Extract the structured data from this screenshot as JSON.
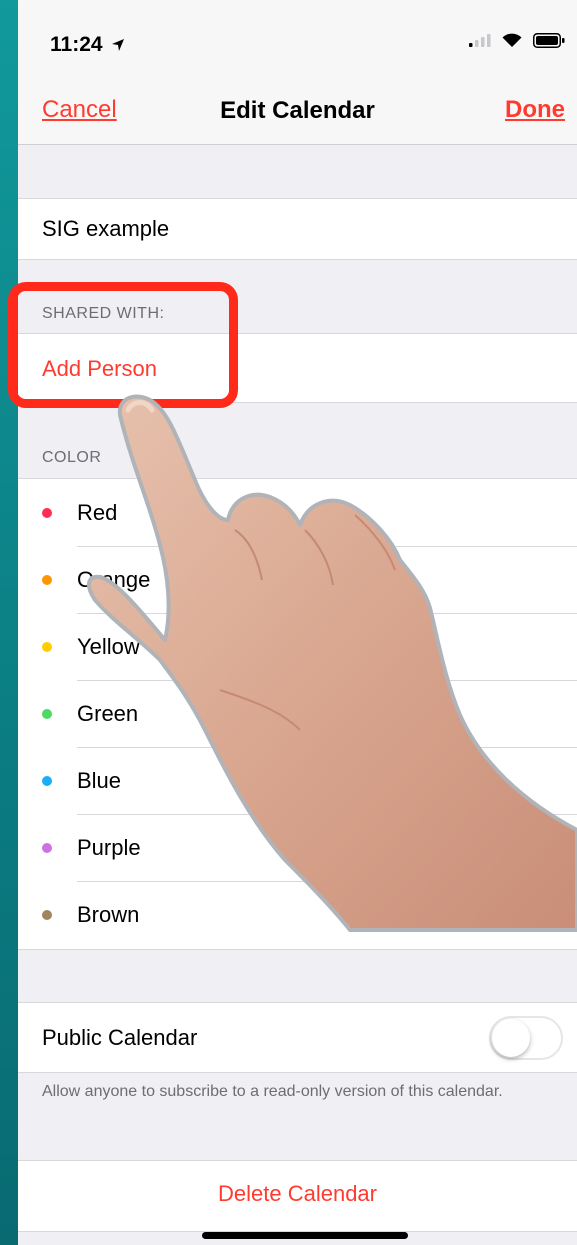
{
  "status_bar": {
    "time": "11:24"
  },
  "nav": {
    "cancel": "Cancel",
    "title": "Edit Calendar",
    "done": "Done"
  },
  "calendar_name": "SIG example",
  "shared": {
    "header": "SHARED WITH:",
    "add_person": "Add Person"
  },
  "color": {
    "header": "COLOR",
    "options": [
      {
        "label": "Red",
        "color": "#ff2d55"
      },
      {
        "label": "Orange",
        "color": "#ff9500"
      },
      {
        "label": "Yellow",
        "color": "#ffcc00"
      },
      {
        "label": "Green",
        "color": "#4cd964"
      },
      {
        "label": "Blue",
        "color": "#1badf8"
      },
      {
        "label": "Purple",
        "color": "#cc73e1"
      },
      {
        "label": "Brown",
        "color": "#a2845e"
      }
    ],
    "selected": "Purple"
  },
  "public_calendar": {
    "label": "Public Calendar",
    "enabled": false,
    "note": "Allow anyone to subscribe to a read-only version of this calendar."
  },
  "delete": "Delete Calendar",
  "icons": {
    "location": "location-arrow-icon",
    "signal": "cellular-signal-icon",
    "wifi": "wifi-icon",
    "battery": "battery-icon",
    "check": "checkmark-icon"
  },
  "colors": {
    "accent": "#ff3b30",
    "background": "#efeff4",
    "highlight": "#ff2a1a"
  }
}
